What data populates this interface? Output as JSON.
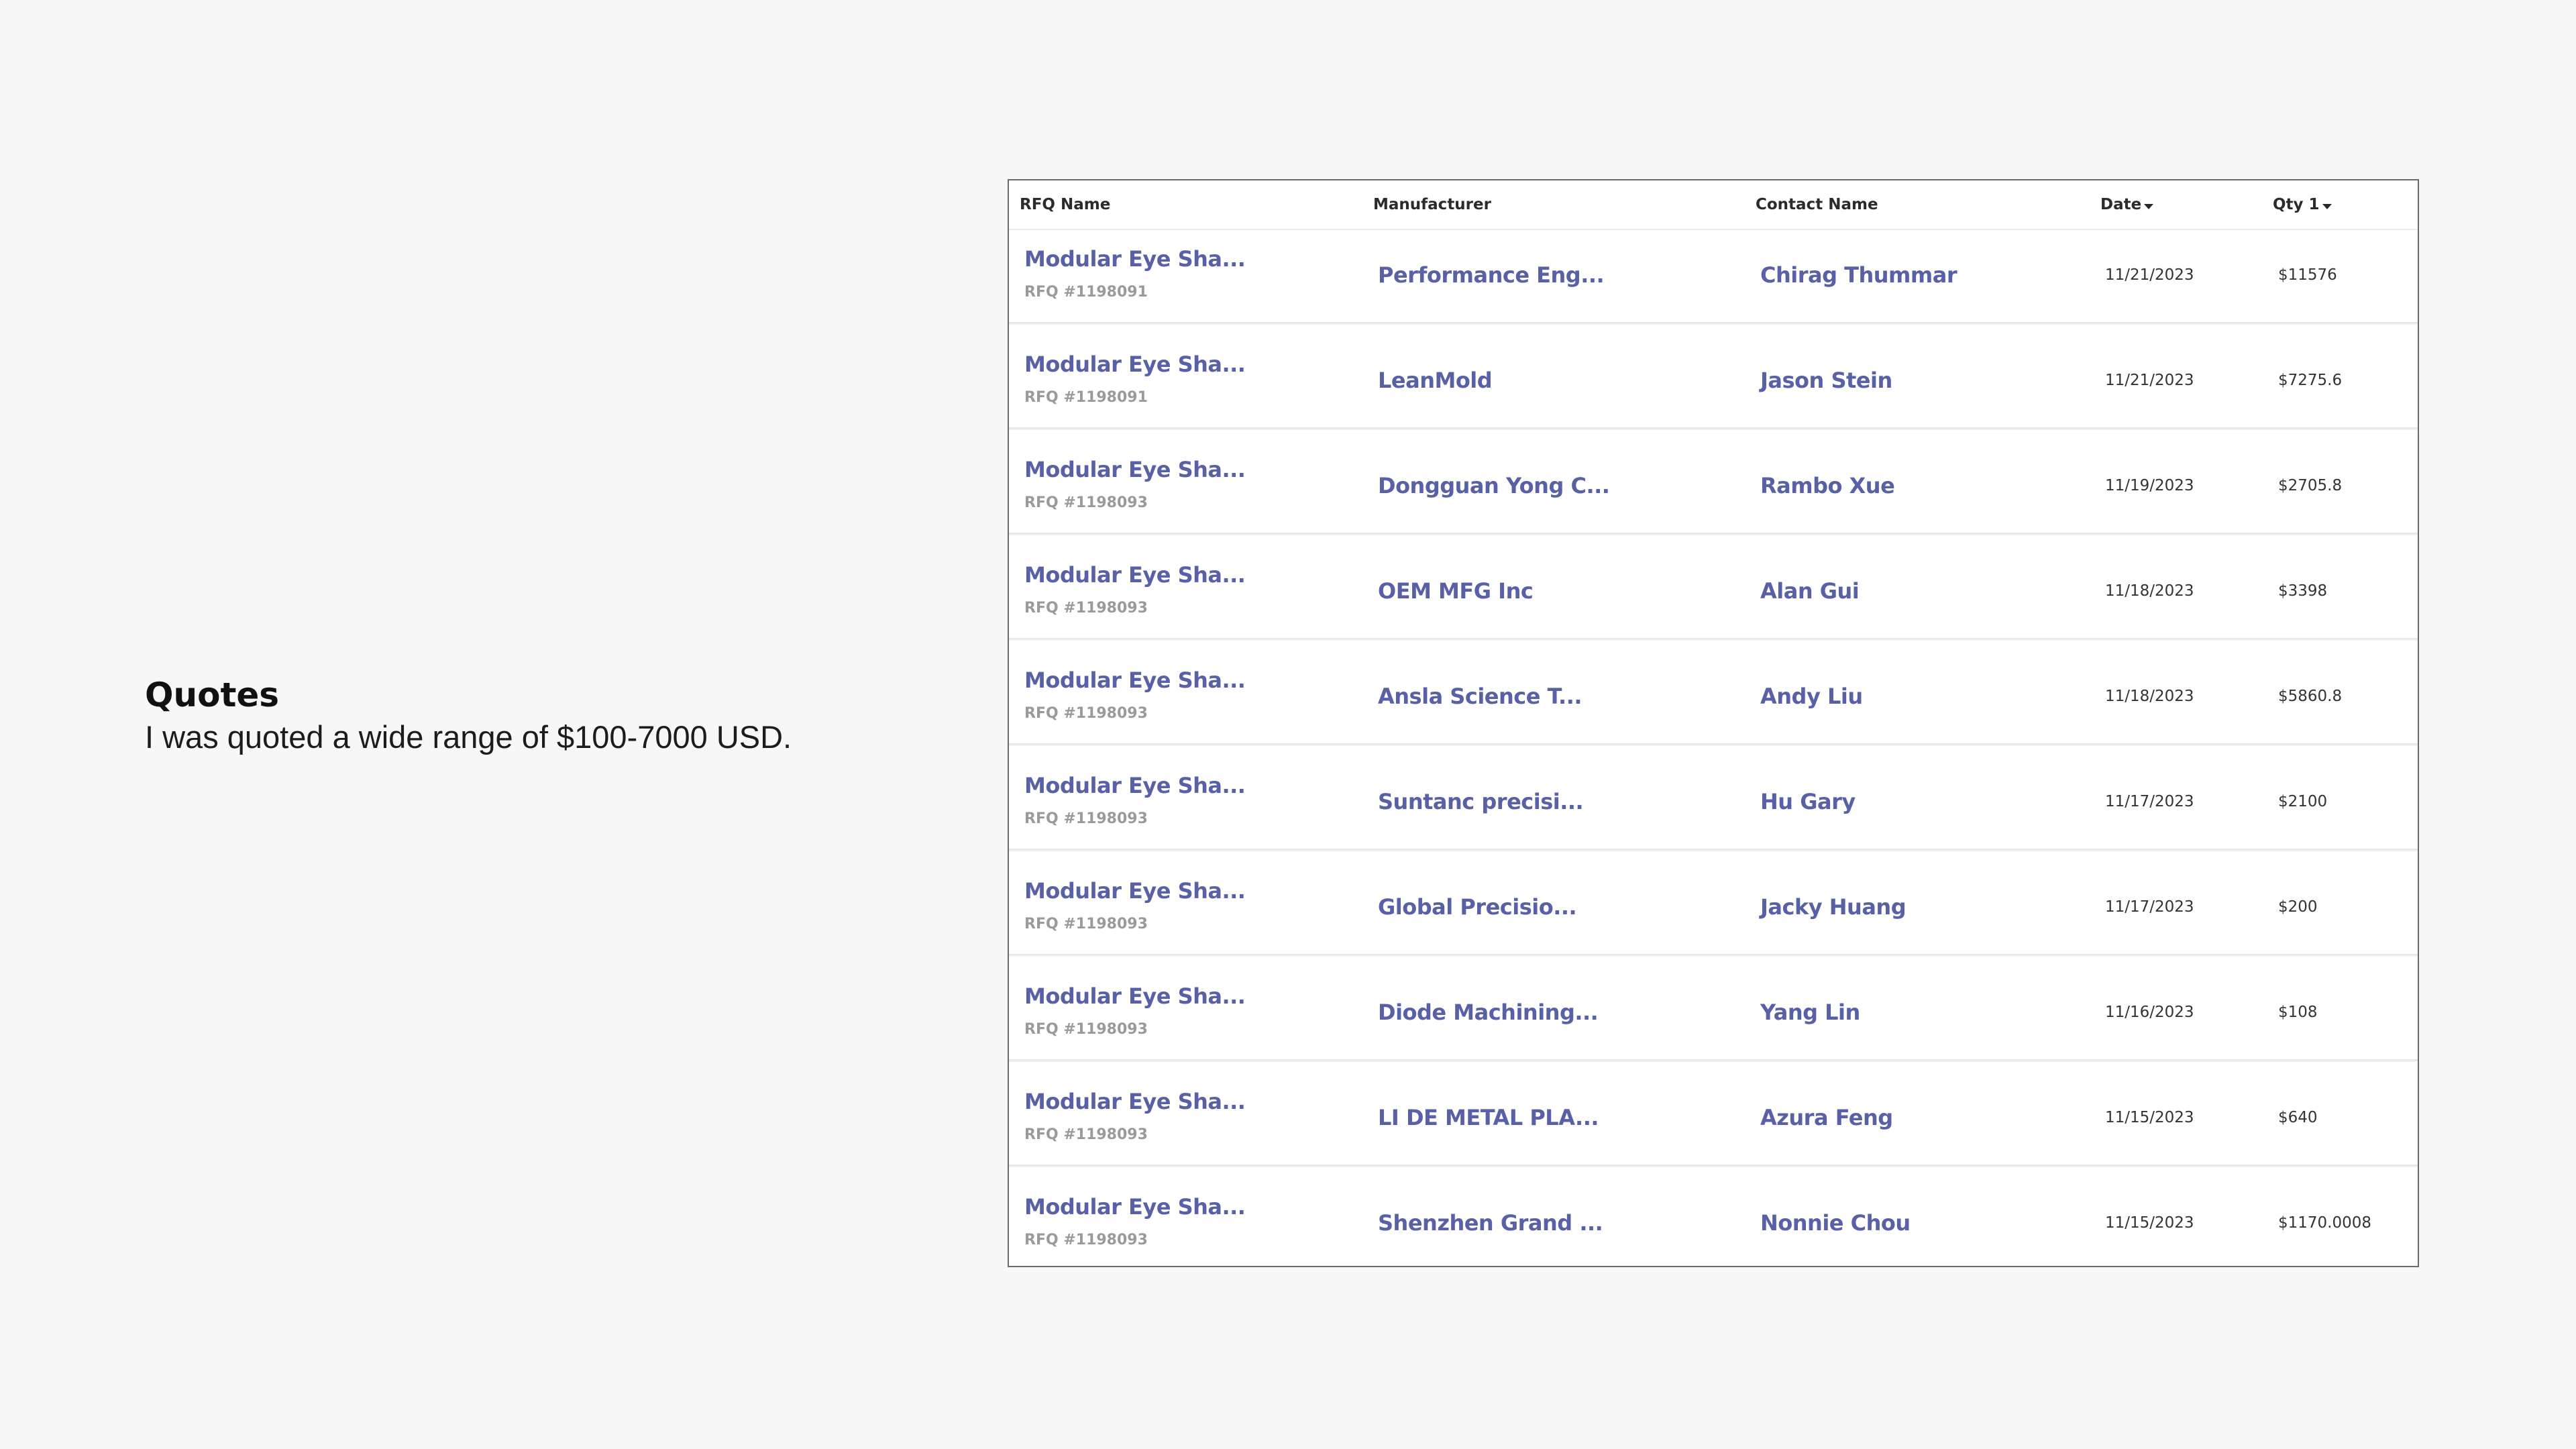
{
  "caption": {
    "title": "Quotes",
    "body": "I was quoted a wide range of $100-7000 USD."
  },
  "table": {
    "headers": {
      "rfq_name": "RFQ Name",
      "manufacturer": "Manufacturer",
      "contact_name": "Contact Name",
      "date": "Date",
      "qty": "Qty 1"
    },
    "rows": [
      {
        "rfq_name": "Modular Eye Sha...",
        "rfq_number": "RFQ #1198091",
        "manufacturer": "Performance Eng...",
        "contact": "Chirag Thummar",
        "date": "11/21/2023",
        "qty": "$11576"
      },
      {
        "rfq_name": "Modular Eye Sha...",
        "rfq_number": "RFQ #1198091",
        "manufacturer": "LeanMold",
        "contact": "Jason Stein",
        "date": "11/21/2023",
        "qty": "$7275.6"
      },
      {
        "rfq_name": "Modular Eye Sha...",
        "rfq_number": "RFQ #1198093",
        "manufacturer": "Dongguan Yong C...",
        "contact": "Rambo Xue",
        "date": "11/19/2023",
        "qty": "$2705.8"
      },
      {
        "rfq_name": "Modular Eye Sha...",
        "rfq_number": "RFQ #1198093",
        "manufacturer": "OEM MFG Inc",
        "contact": "Alan Gui",
        "date": "11/18/2023",
        "qty": "$3398"
      },
      {
        "rfq_name": "Modular Eye Sha...",
        "rfq_number": "RFQ #1198093",
        "manufacturer": "Ansla Science T...",
        "contact": "Andy Liu",
        "date": "11/18/2023",
        "qty": "$5860.8"
      },
      {
        "rfq_name": "Modular Eye Sha...",
        "rfq_number": "RFQ #1198093",
        "manufacturer": "Suntanc precisi...",
        "contact": "Hu Gary",
        "date": "11/17/2023",
        "qty": "$2100"
      },
      {
        "rfq_name": "Modular Eye Sha...",
        "rfq_number": "RFQ #1198093",
        "manufacturer": "Global Precisio...",
        "contact": "Jacky Huang",
        "date": "11/17/2023",
        "qty": "$200"
      },
      {
        "rfq_name": "Modular Eye Sha...",
        "rfq_number": "RFQ #1198093",
        "manufacturer": "Diode Machining...",
        "contact": "Yang Lin",
        "date": "11/16/2023",
        "qty": "$108"
      },
      {
        "rfq_name": "Modular Eye Sha...",
        "rfq_number": "RFQ #1198093",
        "manufacturer": "LI DE METAL PLA...",
        "contact": "Azura Feng",
        "date": "11/15/2023",
        "qty": "$640"
      },
      {
        "rfq_name": "Modular Eye Sha...",
        "rfq_number": "RFQ #1198093",
        "manufacturer": "Shenzhen Grand ...",
        "contact": "Nonnie Chou",
        "date": "11/15/2023",
        "qty": "$1170.0008"
      }
    ]
  }
}
